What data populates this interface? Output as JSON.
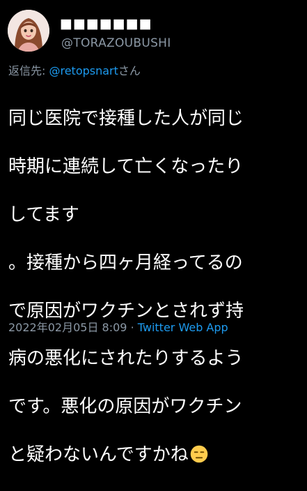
{
  "tweet": {
    "author": {
      "display_name": "■■■■■■■",
      "handle": "@TORAZOUBUSHI",
      "avatar_icon": "avatar-illustration-icon"
    },
    "reply_prefix": "返信先: ",
    "reply_to": "@retopsnart",
    "reply_suffix": "さん",
    "lines": [
      "同じ医院で接種した人が同じ",
      "時期に連続して亡くなったり",
      "してます",
      "。接種から四ヶ月経ってるの",
      "で原因がワクチンとされず持",
      "病の悪化にされたりするよう",
      "です。悪化の原因がワクチン",
      "と疑わないんですかね"
    ],
    "emoji": "expressionless-face-icon",
    "timestamp": "2022年02月05日 8:09",
    "separator": "·",
    "source_app": "Twitter Web App"
  },
  "colors": {
    "background": "#000000",
    "text": "#ffffff",
    "secondary": "#8b98a5",
    "link": "#1d9bf0"
  }
}
